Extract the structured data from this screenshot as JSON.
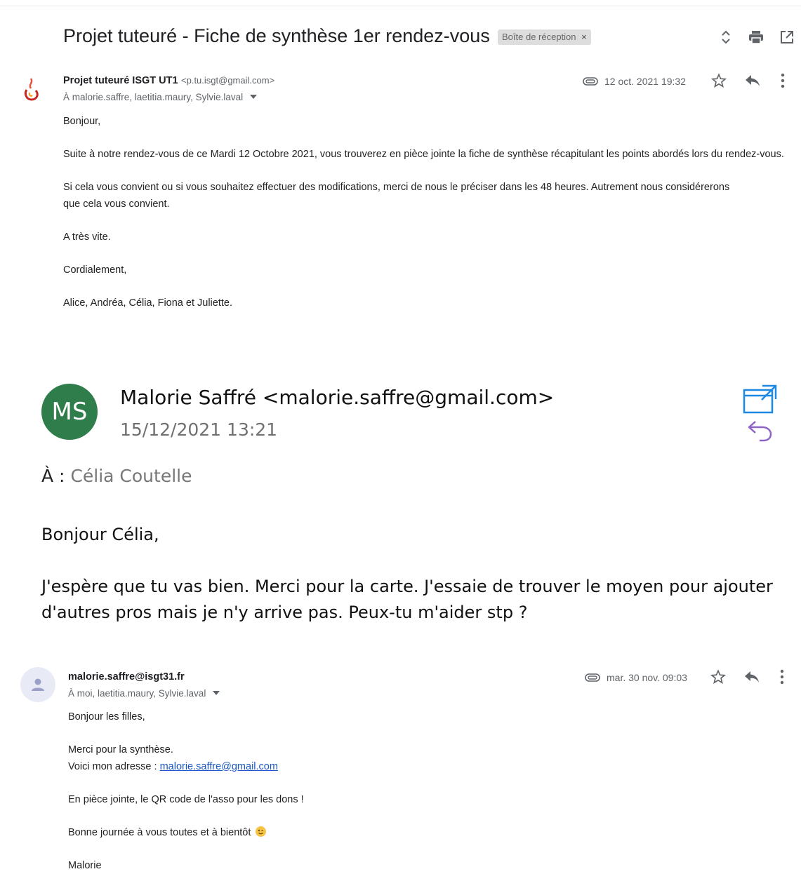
{
  "thread": {
    "subject": "Projet tuteuré - Fiche de synthèse 1er rendez-vous",
    "label": "Boîte de réception",
    "label_close": "×"
  },
  "email1": {
    "sender_name": "Projet tuteuré ISGT UT1",
    "sender_email": "<p.tu.isgt@gmail.com>",
    "recipients": "À malorie.saffre, laetitia.maury, Sylvie.laval",
    "date": "12 oct. 2021 19:32",
    "body": {
      "greeting": "Bonjour,",
      "p1": "Suite à notre rendez-vous de ce Mardi 12 Octobre 2021, vous trouverez en pièce jointe la fiche de synthèse récapitulant les points abordés lors du rendez-vous.",
      "p2": "Si cela vous convient ou si vous souhaitez effectuer des modifications, merci de nous le préciser dans les 48 heures. Autrement nous considérerons que cela vous convient.",
      "p3": "A très vite.",
      "p4": "Cordialement,",
      "p5": "Alice, Andréa, Célia, Fiona et Juliette."
    }
  },
  "email2": {
    "avatar_initials": "MS",
    "from": "Malorie Saffré <malorie.saffre@gmail.com>",
    "date": "15/12/2021 13:21",
    "to_label": "À :",
    "to_value": "Célia Coutelle",
    "greeting": "Bonjour Célia,",
    "line1": "J'espère que tu vas bien. Merci pour la carte. J'essaie de trouver le moyen pour ajouter",
    "line2": "d'autres pros mais je n'y arrive pas. Peux-tu m'aider stp ?"
  },
  "email3": {
    "sender": "malorie.saffre@isgt31.fr",
    "recipients": "À moi, laetitia.maury, Sylvie.laval",
    "date": "mar. 30 nov. 09:03",
    "body": {
      "greeting": "Bonjour les filles,",
      "thanks": "Merci pour la synthèse.",
      "address_prefix": "Voici mon adresse : ",
      "address_link": "malorie.saffre@gmail.com",
      "attachment": "En pièce jointe, le QR code de l'asso pour les dons !",
      "closing": "Bonne journée à vous toutes et à bientôt",
      "signature": "Malorie"
    }
  },
  "colors": {
    "outlook_avatar": "#2e7d4b",
    "outlook_icon": "#1e88e5",
    "reply_purple": "#8e63c7",
    "link": "#1a57c9"
  },
  "icons": [
    "expand-collapse-icon",
    "print-icon",
    "open-in-new-window-icon",
    "attachment-icon",
    "star-icon",
    "reply-icon",
    "more-options-icon",
    "popout-icon",
    "reply-curved-icon",
    "person-icon",
    "isgt-logo"
  ]
}
